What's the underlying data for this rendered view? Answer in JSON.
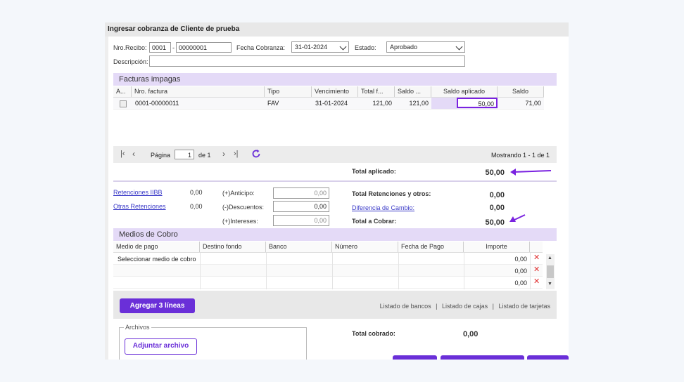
{
  "window": {
    "title": "Ingresar cobranza de Cliente de prueba"
  },
  "form": {
    "nro_recibo_label": "Nro.Recibo:",
    "nro_recibo_prefix": "0001",
    "nro_recibo_sep": "-",
    "nro_recibo_number": "00000001",
    "fecha_label": "Fecha Cobranza:",
    "fecha_value": "31-01-2024",
    "estado_label": "Estado:",
    "estado_value": "Aprobado",
    "descripcion_label": "Descripción:",
    "descripcion_value": ""
  },
  "facturas": {
    "title": "Facturas impagas",
    "headers": [
      "A...",
      "Nro. factura",
      "Tipo",
      "Vencimiento",
      "Total f...",
      "Saldo ...",
      "Saldo aplicado",
      "Saldo"
    ],
    "rows": [
      {
        "nro": "0001-00000011",
        "tipo": "FAV",
        "vencimiento": "31-01-2024",
        "total": "121,00",
        "saldo_prev": "121,00",
        "saldo_aplicado": "50,00",
        "saldo": "71,00"
      }
    ]
  },
  "pager": {
    "page_label": "Página",
    "page_value": "1",
    "of_label": "de 1",
    "showing": "Mostrando 1 - 1 de 1"
  },
  "totals": {
    "total_aplicado_label": "Total aplicado:",
    "total_aplicado_value": "50,00",
    "retenciones_iibb": "Retenciones IIBB",
    "retenciones_iibb_value": "0,00",
    "otras_retenciones": "Otras Retenciones",
    "otras_retenciones_value": "0,00",
    "anticipo_label": "(+)Anticipo:",
    "anticipo_value": "0,00",
    "descuentos_label": "(-)Descuentos:",
    "descuentos_value": "0,00",
    "intereses_label": "(+)Intereses:",
    "intereses_value": "0,00",
    "total_ret_label": "Total Retenciones y otros:",
    "total_ret_value": "0,00",
    "dif_cambio_label": "Diferencia de Cambio:",
    "dif_cambio_value": "0,00",
    "total_cobrar_label": "Total a Cobrar:",
    "total_cobrar_value": "50,00"
  },
  "medios": {
    "title": "Medios de Cobro",
    "headers": [
      "Medio de pago",
      "Destino fondo",
      "Banco",
      "Número",
      "Fecha de Pago",
      "Importe"
    ],
    "rows": [
      {
        "medio": "Seleccionar medio de cobro",
        "importe": "0,00"
      },
      {
        "medio": "",
        "importe": "0,00"
      },
      {
        "medio": "",
        "importe": "0,00"
      }
    ],
    "add_button": "Agregar 3 líneas",
    "links": [
      "Listado de bancos",
      "Listado de cajas",
      "Listado de tarjetas"
    ],
    "link_sep": "|"
  },
  "archivos": {
    "legend": "Archivos",
    "button": "Adjuntar archivo"
  },
  "cobrado": {
    "label": "Total cobrado:",
    "value": "0,00"
  },
  "colors": {
    "accent": "#6a2fd8",
    "section_bg": "#e4daf7",
    "delete": "#e03030"
  }
}
